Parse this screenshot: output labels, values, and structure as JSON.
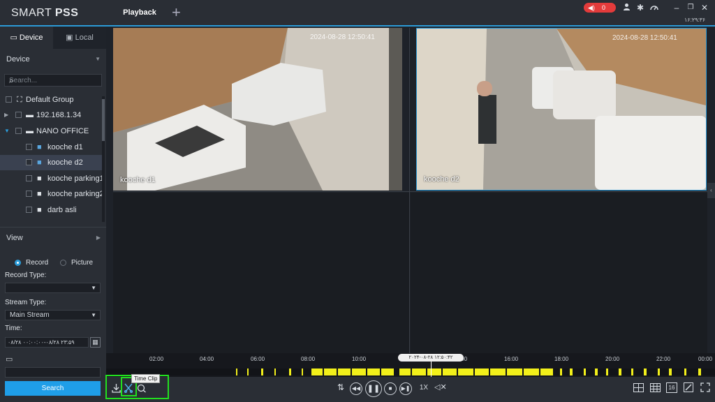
{
  "app": {
    "brand_light": "SMART ",
    "brand_bold": "PSS"
  },
  "tabs": {
    "playback": "Playback",
    "add": "+"
  },
  "topbar": {
    "alarm_count": "0",
    "clock": "۱۶:۲۹:۳۶"
  },
  "sidebar": {
    "device_tab": "Device",
    "local_tab": "Local",
    "device_section": "Device",
    "search_placeholder": "Search...",
    "tree": {
      "default_group": "Default Group",
      "ip_node": "192.168.1.34",
      "nano_office": "NANO OFFICE",
      "channels": [
        "kooche d1",
        "kooche d2",
        "kooche parking1",
        "kooche parking2",
        "darb asli"
      ]
    },
    "view_section": "View",
    "record_option": "Record",
    "picture_option": "Picture",
    "record_type_label": "Record Type:",
    "record_type_value": "",
    "stream_type_label": "Stream Type:",
    "stream_type_value": "Main Stream",
    "time_label": "Time:",
    "time_value": "۰۸/۲۸ ۰۰:۰۰:۰۰-۰۸/۲۸ ۲۳:۵۹",
    "search_button": "Search"
  },
  "video": {
    "cam1_label": "kooche d1",
    "cam1_timestamp": "2024-08-28 12:50:41",
    "cam2_label": "kooche d2",
    "cam2_timestamp": "2024-08-28 12:50:41"
  },
  "timeline": {
    "ticks": [
      "02:00",
      "04:00",
      "06:00",
      "08:00",
      "10:00",
      "14:00",
      "16:00",
      "18:00",
      "20:00",
      "22:00",
      "00:00"
    ],
    "current_time": "۲۰۲۴-۰۸-۲۸ ۱۲:۵۰:۴۲"
  },
  "controls": {
    "speed": "1X",
    "tooltip": "Time Clip",
    "layout_16": "16"
  },
  "colors": {
    "accent": "#2b9bd8",
    "highlight": "#22e01f",
    "record": "#f2f01a",
    "alarm": "#e33b3b"
  }
}
